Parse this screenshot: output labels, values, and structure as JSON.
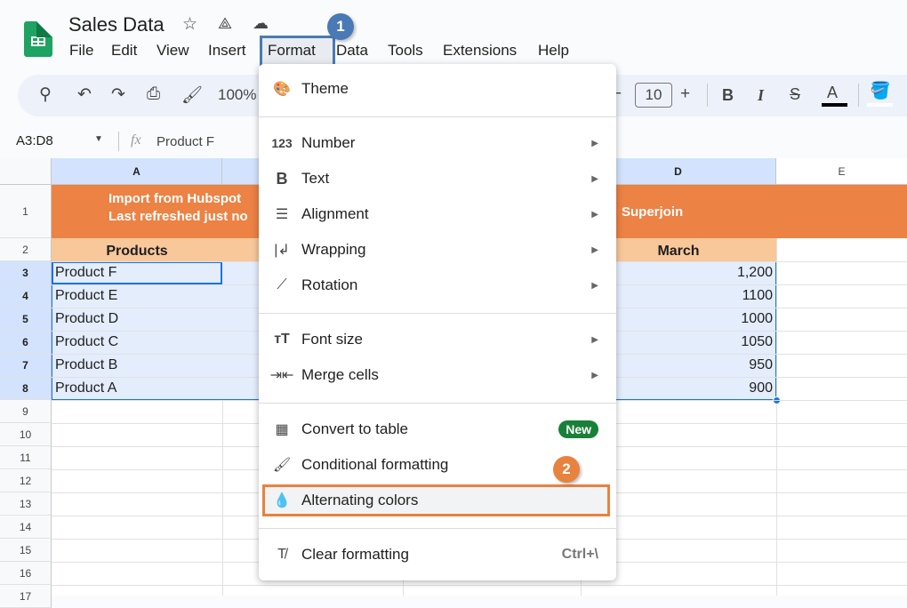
{
  "app": {
    "title": "Sales Data",
    "icons": [
      "star-icon",
      "drive-add-icon",
      "cloud-saved-icon"
    ]
  },
  "menubar": [
    "File",
    "Edit",
    "View",
    "Insert",
    "Format",
    "Data",
    "Tools",
    "Extensions",
    "Help"
  ],
  "annotations": {
    "step1": "1",
    "step2": "2",
    "step1_color": "#4a7ab5",
    "step2_color": "#e8823f"
  },
  "toolbar": {
    "zoom": "100%",
    "font_size": "10",
    "minus": "−",
    "plus": "+",
    "bold": "B",
    "italic": "I",
    "text_color": "A"
  },
  "formula_bar": {
    "range": "A3:D8",
    "fx": "fx",
    "content": "Product F"
  },
  "columns": [
    "A",
    "B",
    "C",
    "D",
    "E"
  ],
  "rows": [
    "1",
    "2",
    "3",
    "4",
    "5",
    "6",
    "7",
    "8",
    "9",
    "10",
    "11",
    "12",
    "13",
    "14",
    "15",
    "16",
    "17"
  ],
  "sheet": {
    "banner_line1": "Import from Hubspot",
    "banner_line2": "Last refreshed just no",
    "banner_right": "Superjoin",
    "header_a": "Products",
    "header_d": "March",
    "products": [
      "Product F",
      "Product E",
      "Product D",
      "Product C",
      "Product B",
      "Product A"
    ],
    "march": [
      "1,200",
      "1100",
      "1000",
      "1050",
      "950",
      "900"
    ],
    "colors": {
      "banner": "#ec8244",
      "header": "#f8c89a",
      "selection": "#e4edfc"
    }
  },
  "format_menu": {
    "theme": "Theme",
    "number": "Number",
    "text": "Text",
    "alignment": "Alignment",
    "wrapping": "Wrapping",
    "rotation": "Rotation",
    "font_size": "Font size",
    "merge_cells": "Merge cells",
    "convert_to_table": "Convert to table",
    "new_badge": "New",
    "conditional_formatting": "Conditional formatting",
    "alternating_colors": "Alternating colors",
    "clear_formatting": "Clear formatting",
    "clear_shortcut": "Ctrl+\\"
  }
}
